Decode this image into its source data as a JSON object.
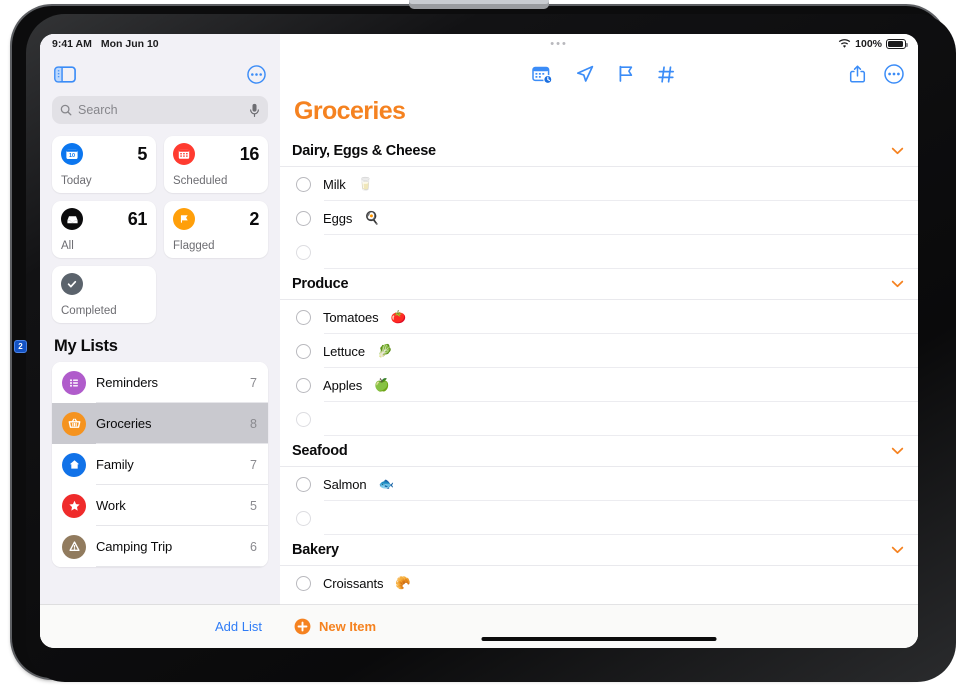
{
  "status_bar": {
    "time": "9:41 AM",
    "date": "Mon Jun 10",
    "wifi_icon": "wifi-icon",
    "battery_percent": "100%",
    "multitask_dots": "•••"
  },
  "callout": {
    "number": "2"
  },
  "sidebar": {
    "toggle_icon": "sidebar-toggle-icon",
    "more_icon": "circle-ellipsis-icon",
    "search": {
      "placeholder": "Search",
      "search_icon": "search-icon",
      "mic_icon": "microphone-icon"
    },
    "smart_lists": [
      {
        "name": "Today",
        "count": "5",
        "icon": "calendar-day-icon",
        "color": "#0b76ef",
        "badge_text": "10"
      },
      {
        "name": "Scheduled",
        "count": "16",
        "icon": "calendar-icon",
        "color": "#ff3b30",
        "badge_text": ""
      },
      {
        "name": "All",
        "count": "61",
        "icon": "inbox-tray-icon",
        "color": "#0b0b0c",
        "badge_text": ""
      },
      {
        "name": "Flagged",
        "count": "2",
        "icon": "flag-icon",
        "color": "#ff9f0a",
        "badge_text": ""
      },
      {
        "name": "Completed",
        "count": "",
        "icon": "checkmark-circle-icon",
        "color": "#5b636c",
        "badge_text": ""
      }
    ],
    "my_lists_header": "My Lists",
    "lists": [
      {
        "name": "Reminders",
        "count": "7",
        "icon": "bullet-list-icon",
        "color": "#b05ccb"
      },
      {
        "name": "Groceries",
        "count": "8",
        "icon": "basket-icon",
        "color": "#f5931f",
        "selected": true
      },
      {
        "name": "Family",
        "count": "7",
        "icon": "house-icon",
        "color": "#1172e8"
      },
      {
        "name": "Work",
        "count": "5",
        "icon": "star-icon",
        "color": "#ef2b2b"
      },
      {
        "name": "Camping Trip",
        "count": "6",
        "icon": "tent-warning-icon",
        "color": "#917b5e"
      }
    ],
    "add_list_label": "Add List"
  },
  "main": {
    "toolbar": [
      {
        "name": "schedule-date-icon",
        "label": "Add Date"
      },
      {
        "name": "location-arrow-icon",
        "label": "Add Location"
      },
      {
        "name": "flag-icon",
        "label": "Flag"
      },
      {
        "name": "hashtag-icon",
        "label": "Add Tag"
      }
    ],
    "share_icon": "share-icon",
    "more_icon": "circle-ellipsis-icon",
    "title": "Groceries",
    "accent_color": "#f58220",
    "sections": [
      {
        "title": "Dairy, Eggs & Cheese",
        "chevron_icon": "chevron-down-icon",
        "items": [
          {
            "text": "Milk",
            "emoji": "🥛"
          },
          {
            "text": "Eggs",
            "emoji": "🍳"
          },
          {
            "text": "",
            "emoji": "",
            "empty": true
          }
        ]
      },
      {
        "title": "Produce",
        "chevron_icon": "chevron-down-icon",
        "items": [
          {
            "text": "Tomatoes",
            "emoji": "🍅"
          },
          {
            "text": "Lettuce",
            "emoji": "🥬"
          },
          {
            "text": "Apples",
            "emoji": "🍏"
          },
          {
            "text": "",
            "emoji": "",
            "empty": true
          }
        ]
      },
      {
        "title": "Seafood",
        "chevron_icon": "chevron-down-icon",
        "items": [
          {
            "text": "Salmon",
            "emoji": "🐟"
          },
          {
            "text": "",
            "emoji": "",
            "empty": true
          }
        ]
      },
      {
        "title": "Bakery",
        "chevron_icon": "chevron-down-icon",
        "items": [
          {
            "text": "Croissants",
            "emoji": "🥐"
          }
        ]
      }
    ],
    "new_item_label": "New Item",
    "new_item_icon": "plus-circle-icon"
  }
}
